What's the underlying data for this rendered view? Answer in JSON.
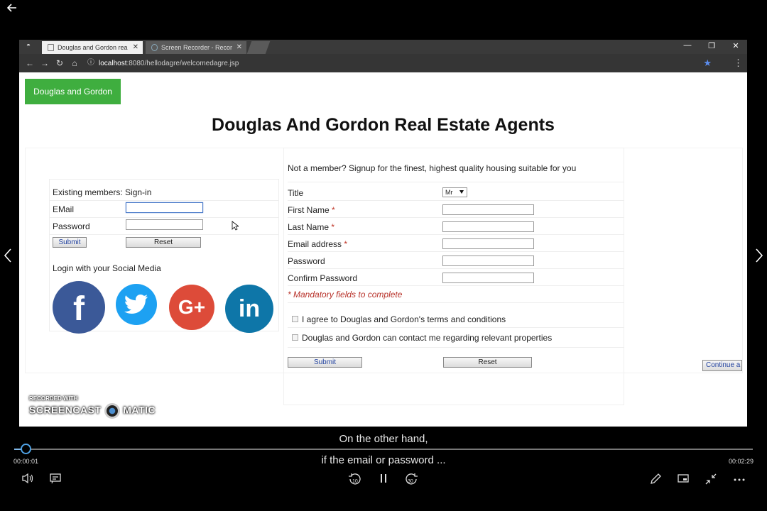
{
  "browser": {
    "tabs": [
      {
        "title": "Douglas and Gordon rea",
        "active": true
      },
      {
        "title": "Screen Recorder - Recor",
        "active": false
      }
    ],
    "url_host": "localhost",
    "url_rest": ":8080/hellodagre/welcomedagre.jsp"
  },
  "page": {
    "brand_button": "Douglas and Gordon",
    "title": "Douglas And Gordon Real Estate Agents",
    "login": {
      "heading": "Existing members: Sign-in",
      "email_label": "EMail",
      "email_value": "",
      "password_label": "Password",
      "password_value": "",
      "submit_label": "Submit",
      "reset_label": "Reset",
      "social_heading": "Login with your Social Media",
      "social": [
        {
          "name": "facebook",
          "glyph": "f",
          "color": "#3b5998"
        },
        {
          "name": "twitter",
          "glyph": "🐦",
          "color": "#1da1f2"
        },
        {
          "name": "google-plus",
          "glyph": "G+",
          "color": "#dd4b39"
        },
        {
          "name": "linkedin",
          "glyph": "in",
          "color": "#0e76a8"
        }
      ]
    },
    "signup": {
      "heading": "Not a member? Signup for the finest, highest quality housing suitable for you",
      "title_label": "Title",
      "title_value": "Mr",
      "first_name_label": "First Name",
      "last_name_label": "Last Name",
      "email_label": "Email address",
      "password_label": "Password",
      "confirm_label": "Confirm Password",
      "required_marker": "*",
      "mandatory_note": "* Mandatory fields to complete",
      "agree_terms": "I agree to Douglas and Gordon's terms and conditions",
      "contact_consent": "Douglas and Gordon can contact me regarding relevant properties",
      "submit_label": "Submit",
      "reset_label": "Reset"
    },
    "continue_label": "Continue a"
  },
  "watermark": {
    "line1": "RECORDED WITH",
    "line2": "SCREENCAST",
    "line3": "MATIC"
  },
  "player": {
    "subtitle_line1": "On the other hand,",
    "subtitle_line2": "if the email or password ...",
    "time_current": "00:00:01",
    "time_total": "00:02:29",
    "progress_fraction": 0.007,
    "rewind_label": "10",
    "forward_label": "30"
  }
}
